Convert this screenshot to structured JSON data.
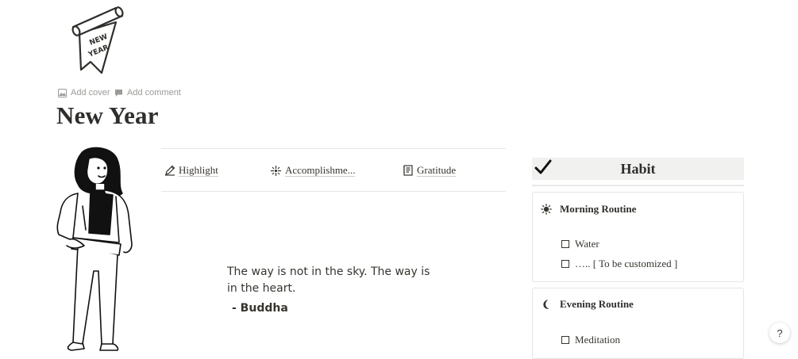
{
  "page": {
    "icon_text": "NEW YEAR",
    "add_cover": "Add cover",
    "add_comment": "Add comment",
    "title": "New Year"
  },
  "links": {
    "highlight": "Highlight",
    "accomplishments": "Accomplishme...",
    "gratitude": "Gratitude"
  },
  "quote": {
    "text": "The way is not in the sky. The way is in the heart.",
    "author": "- Buddha"
  },
  "habit": {
    "title": "Habit",
    "morning": {
      "title": "Morning Routine",
      "items": [
        "Water",
        "…..  [ To be customized ]"
      ]
    },
    "evening": {
      "title": "Evening Routine",
      "items": [
        "Meditation"
      ]
    }
  },
  "help": {
    "label": "?"
  },
  "colors": {
    "text": "#37352f",
    "muted": "#9b9a97",
    "callout_bg": "#f1f1ef",
    "border": "#e6e5e2"
  },
  "icons": [
    "new-year-banner-icon",
    "image-icon",
    "comment-icon",
    "pencil-icon",
    "sparkle-icon",
    "notebook-icon",
    "checkmark-icon",
    "sun-icon",
    "moon-icon"
  ]
}
